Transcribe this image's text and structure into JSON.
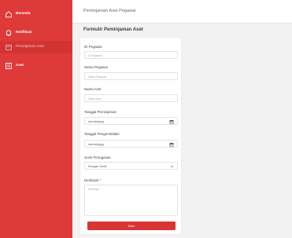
{
  "sidebar": {
    "items": [
      {
        "label": "Beranda",
        "icon": "home-icon"
      },
      {
        "label": "Notifikasi",
        "icon": "bell-icon"
      },
      {
        "label": "Peminjaman Aset",
        "icon": "box-icon",
        "active": true
      },
      {
        "label": "Aset",
        "icon": "list-icon"
      }
    ]
  },
  "topbar": {
    "title": "Peminjaman Aset Pegawai"
  },
  "form": {
    "title": "Formulir Peminjaman Aset",
    "id_label": "ID Pegawai",
    "id_placeholder": "ID Pegawai",
    "name_label": "Nama Pegawai",
    "name_placeholder": "Nama Pegawai",
    "asset_label": "Nama Aset",
    "asset_placeholder": "Nama Aset",
    "borrow_date_label": "Tanggal Peminjaman",
    "borrow_date_value": "mm/dd/yyyy",
    "return_date_label": "Tanggal Pengembalian",
    "return_date_value": "mm/dd/yyyy",
    "type_label": "Jenis Penugasan",
    "type_value": "Dengan Surat",
    "desc_label": "Deskripsi *",
    "desc_placeholder": "Deskripsi",
    "submit_label": "Kirim"
  },
  "colors": {
    "accent": "#de3a3a",
    "button": "#d83535"
  }
}
